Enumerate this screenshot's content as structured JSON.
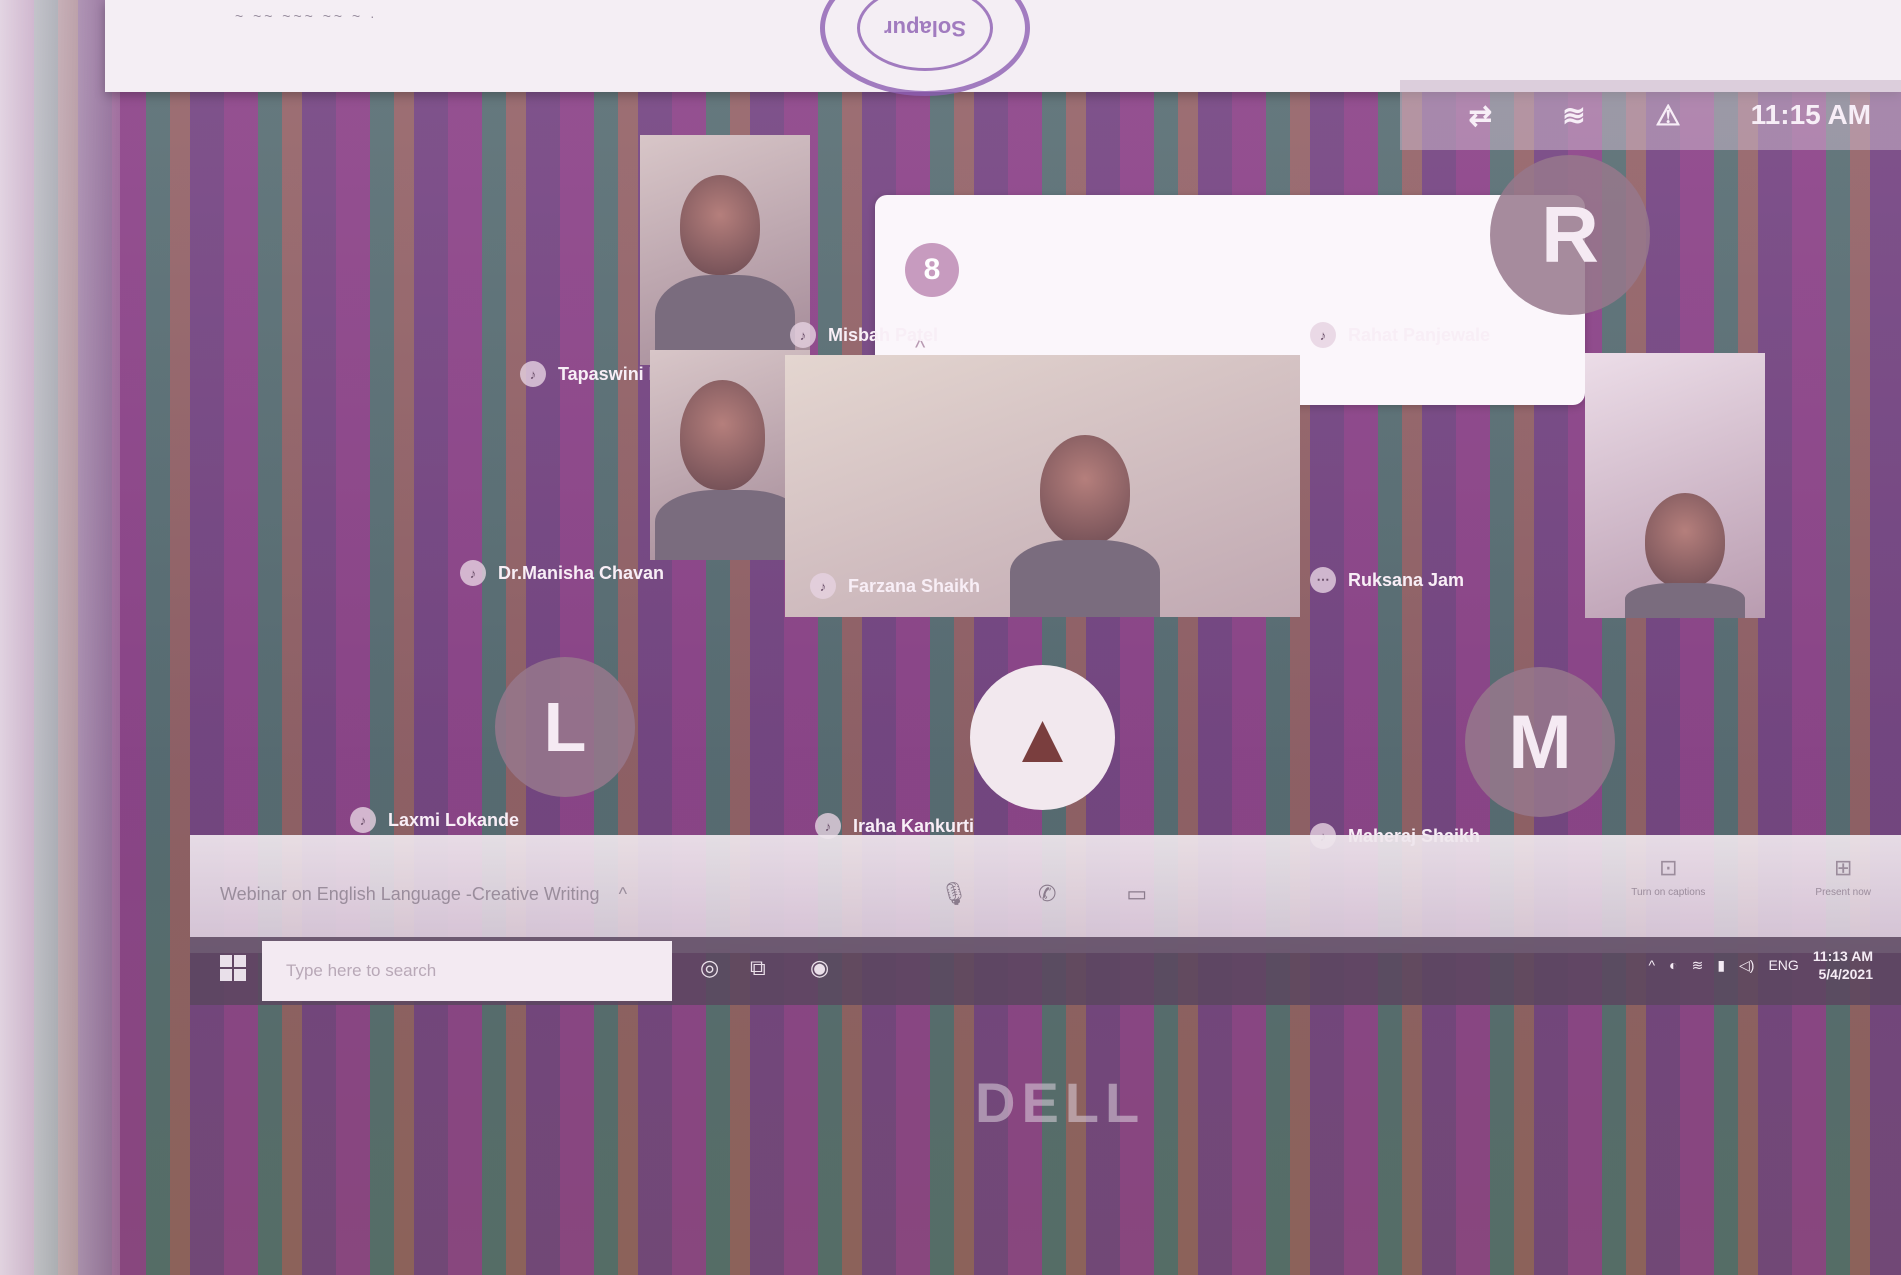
{
  "stamp": {
    "text": "Solapur"
  },
  "system_tray_top": {
    "time": "11:15 AM"
  },
  "notification": {
    "badge": "8",
    "caret": "^"
  },
  "participants": [
    {
      "name": "Tapaswini Patil",
      "type": "video"
    },
    {
      "name": "Misbah Patel",
      "type": "none"
    },
    {
      "name": "Rahat Panjewale",
      "type": "avatar",
      "initial": "R"
    },
    {
      "name": "Dr.Manisha Chavan",
      "type": "video"
    },
    {
      "name": "Farzana Shaikh",
      "type": "video"
    },
    {
      "name": "Ruksana Jam",
      "type": "video"
    },
    {
      "name": "Laxmi Lokande",
      "type": "avatar",
      "initial": "L"
    },
    {
      "name": "Iraha Kankurti",
      "type": "avatar_image"
    },
    {
      "name": "Maheraj Shaikh",
      "type": "avatar",
      "initial": "M"
    }
  ],
  "meet_bar": {
    "title": "Webinar on English Language -Creative Writing",
    "caret": "^",
    "turn_on_captions": "Turn on captions",
    "present_now": "Present now"
  },
  "taskbar": {
    "search_placeholder": "Type here to search",
    "lang": "ENG",
    "time": "11:13 AM",
    "date": "5/4/2021"
  },
  "monitor": {
    "brand": "DELL"
  }
}
